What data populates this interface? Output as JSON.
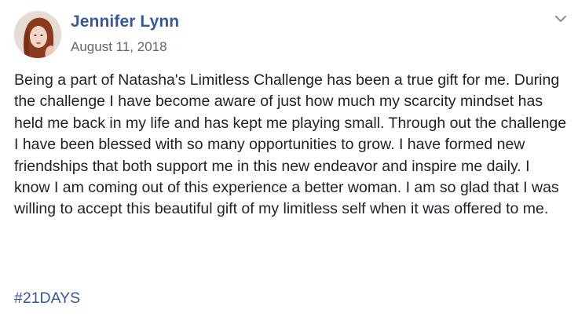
{
  "post": {
    "author": "Jennifer Lynn",
    "date": "August 11, 2018",
    "body": "Being a part of Natasha's Limitless Challenge has been a true gift for me. During the challenge I have become aware of just how much my scarcity mindset has held me back in my life and has kept me playing small. Through out the challenge I have been blessed with so many opportunities to grow. I have formed new friendships that both support me in this new endeavor and inspire me daily. I know I am coming out of this experience a better woman. I am so glad that I was willing to accept this beautiful gift of my limitless self when it was offered to me.",
    "hashtag": "#21DAYS"
  },
  "colors": {
    "link": "#385898",
    "text": "#1d2129",
    "meta": "#616770",
    "background": "#ffffff"
  },
  "icons": {
    "avatar": "profile-photo",
    "menu": "chevron-down-icon"
  }
}
